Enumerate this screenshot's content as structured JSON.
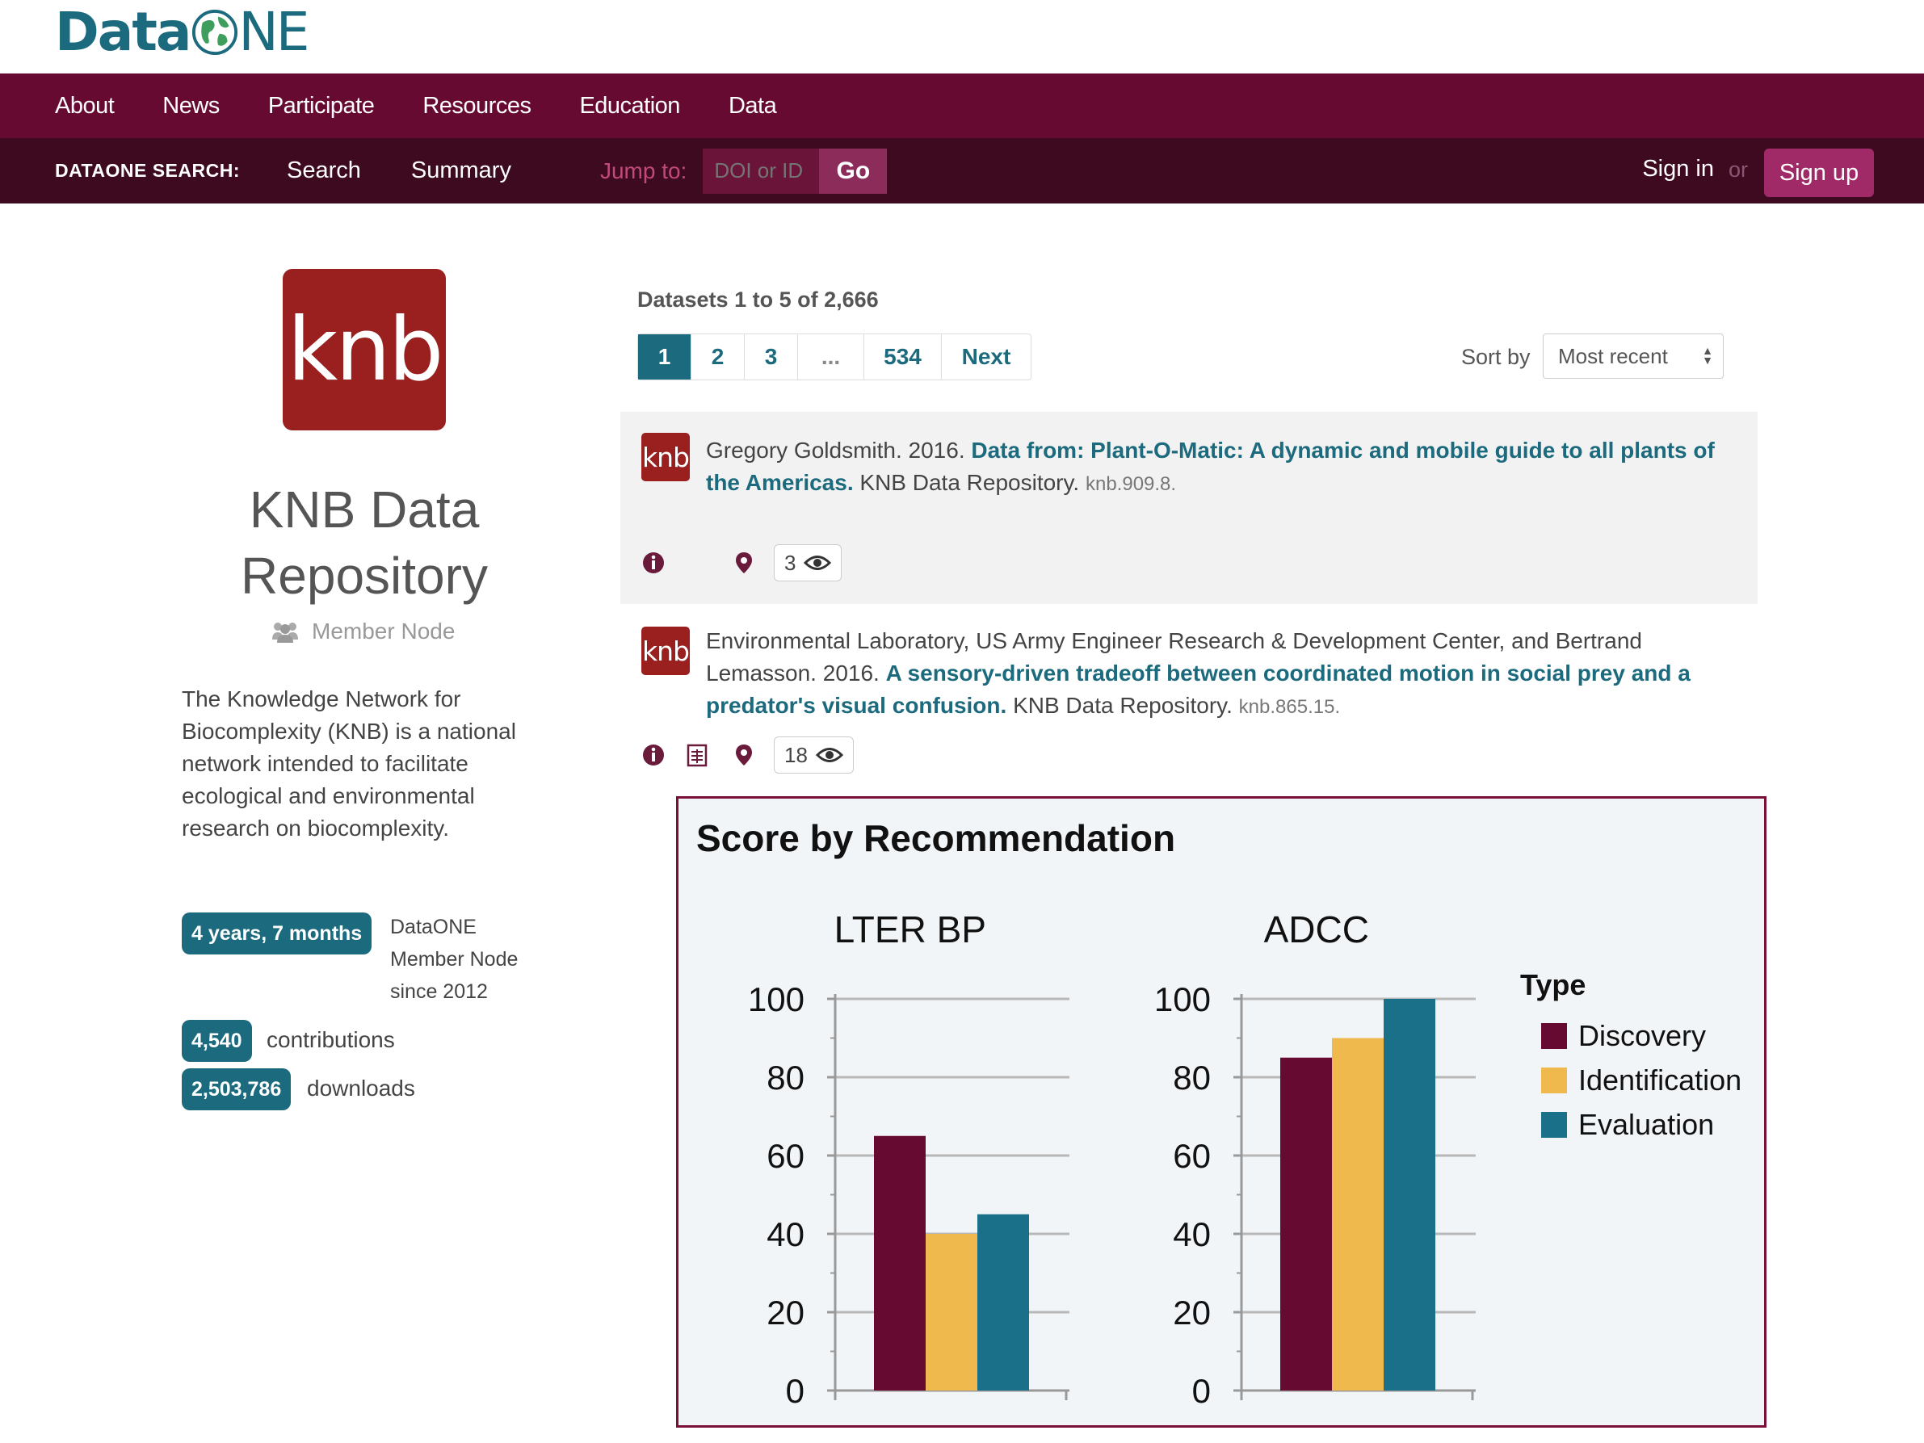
{
  "header": {
    "logo_text": "Data",
    "logo_suffix": "NE",
    "nav": [
      "About",
      "News",
      "Participate",
      "Resources",
      "Education",
      "Data"
    ],
    "search_label": "DATAONE SEARCH:",
    "search_links": [
      "Search",
      "Summary"
    ],
    "jump_label": "Jump to:",
    "jump_placeholder": "DOI or ID",
    "go_label": "Go",
    "signin_label": "Sign in",
    "or_label": "or",
    "signup_label": "Sign up"
  },
  "sidebar": {
    "logo_text": "knb",
    "title": "KNB Data Repository",
    "node_type": "Member Node",
    "description": "The Knowledge Network for Biocomplexity (KNB) is a national network intended to facilitate ecological and environmental research on biocomplexity.",
    "age_badge": "4 years, 7 months",
    "since_text": "DataONE Member Node since 2012",
    "contributions_count": "4,540",
    "contributions_label": "contributions",
    "downloads_count": "2,503,786",
    "downloads_label": "downloads"
  },
  "results": {
    "count_text": "Datasets 1 to 5 of 2,666",
    "pages": [
      "1",
      "2",
      "3",
      "...",
      "534",
      "Next"
    ],
    "sort_label": "Sort by",
    "sort_value": "Most recent",
    "items": [
      {
        "logo": "knb",
        "authors": "Gregory Goldsmith. 2016. ",
        "title": "Data from: Plant-O-Matic: A dynamic and mobile guide to all plants of the Americas.",
        "publisher": " KNB Data Repository. ",
        "pid": "knb.909.8.",
        "views": "3"
      },
      {
        "logo": "knb",
        "authors": "Environmental Laboratory, US Army Engineer Research & Development Center, and Bertrand Lemasson. 2016. ",
        "title": "A sensory-driven tradeoff between coordinated motion in social prey and a predator's visual confusion.",
        "publisher": " KNB Data Repository. ",
        "pid": "knb.865.15.",
        "views": "18"
      }
    ]
  },
  "chart_data": {
    "type": "bar",
    "title": "Score by Recommendation",
    "panels": [
      {
        "title": "LTER BP",
        "series": [
          {
            "name": "Discovery",
            "value": 65
          },
          {
            "name": "Identification",
            "value": 40
          },
          {
            "name": "Evaluation",
            "value": 45
          }
        ]
      },
      {
        "title": "ADCC",
        "series": [
          {
            "name": "Discovery",
            "value": 85
          },
          {
            "name": "Identification",
            "value": 90
          },
          {
            "name": "Evaluation",
            "value": 100
          }
        ]
      }
    ],
    "ylim": [
      0,
      100
    ],
    "yticks": [
      0,
      20,
      40,
      60,
      80,
      100
    ],
    "legend_title": "Type",
    "legend": [
      {
        "name": "Discovery",
        "color": "#660a31"
      },
      {
        "name": "Identification",
        "color": "#efb94e"
      },
      {
        "name": "Evaluation",
        "color": "#1a7088"
      }
    ],
    "legend_position": "right",
    "grid": true
  }
}
